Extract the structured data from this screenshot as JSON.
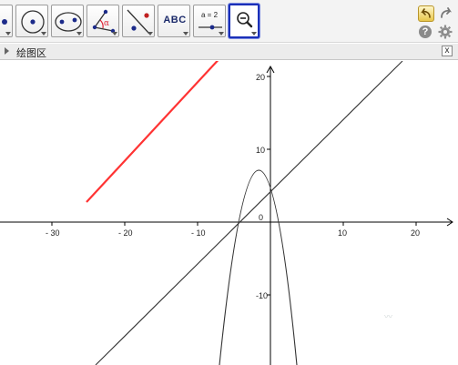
{
  "toolbar": {
    "tools": [
      {
        "name": "point-tool",
        "icon": "point-icon"
      },
      {
        "name": "circle-center-point-tool",
        "icon": "circle-center-icon"
      },
      {
        "name": "conic-tool",
        "icon": "ellipse-icon"
      },
      {
        "name": "angle-tool",
        "icon": "angle-icon",
        "glyph": "α"
      },
      {
        "name": "reflect-tool",
        "icon": "reflect-icon"
      },
      {
        "name": "text-tool",
        "icon": "text-icon",
        "label": "ABC"
      },
      {
        "name": "slider-tool",
        "icon": "slider-icon",
        "label": "a = 2"
      },
      {
        "name": "zoom-out-tool",
        "icon": "zoom-out-icon",
        "selected": true
      }
    ],
    "undo_icon": "undo-icon",
    "redo_icon": "redo-icon",
    "help_label": "?",
    "settings_icon": "gear-icon"
  },
  "panel": {
    "title": "绘图区",
    "close_label": "x"
  },
  "graphics": {
    "x_ticks": [
      "- 30",
      "- 20",
      "- 10",
      "10",
      "20"
    ],
    "y_ticks": [
      "20",
      "10",
      "-10"
    ],
    "origin_label": "0",
    "colors": {
      "axis": "#000000",
      "curve": "#333333",
      "arrow": "#ff3333"
    }
  },
  "watermark": "〰"
}
